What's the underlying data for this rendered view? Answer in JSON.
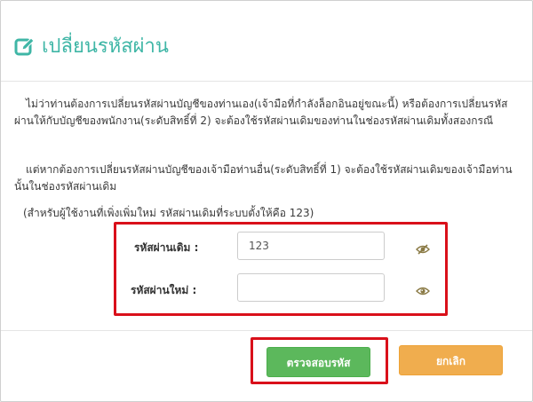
{
  "dialog": {
    "title": "เปลี่ยนรหัสผ่าน",
    "icon": "edit-icon",
    "accent_color": "#3fb6a6"
  },
  "body": {
    "paragraph_1": "ไม่ว่าท่านต้องการเปลี่ยนรหัสผ่านบัญชีของท่านเอง(เจ้ามือที่กำลังล็อกอินอยู่ขณะนี้) หรือต้องการเปลี่ยนรหัสผ่านให้กับบัญชีของพนักงาน(ระดับสิทธิ์ที่ 2) จะต้องใช้รหัสผ่านเดิมของท่านในช่องรหัสผ่านเดิมทั้งสองกรณี",
    "paragraph_2": "แต่หากต้องการเปลี่ยนรหัสผ่านบัญชีของเจ้ามือท่านอื่น(ระดับสิทธิ์ที่ 1) จะต้องใช้รหัสผ่านเดิมของเจ้ามือท่านนั้นในช่องรหัสผ่านเดิม",
    "paragraph_3": "(สำหรับผู้ใช้งานที่เพิ่งเพิ่มใหม่ รหัสผ่านเดิมที่ระบบตั้งให้คือ 123)"
  },
  "form": {
    "old_password_label": "รหัสผ่านเดิม :",
    "old_password_value": "123",
    "old_password_icon": "eye-slash-icon",
    "new_password_label": "รหัสผ่านใหม่ :",
    "new_password_value": "",
    "new_password_icon": "eye-icon",
    "highlight_color": "#d9101a"
  },
  "footer": {
    "confirm_label": "ตรวจสอบรหัส",
    "cancel_label": "ยกเลิก",
    "confirm_color": "#5cb85c",
    "cancel_color": "#f0ad4e"
  }
}
